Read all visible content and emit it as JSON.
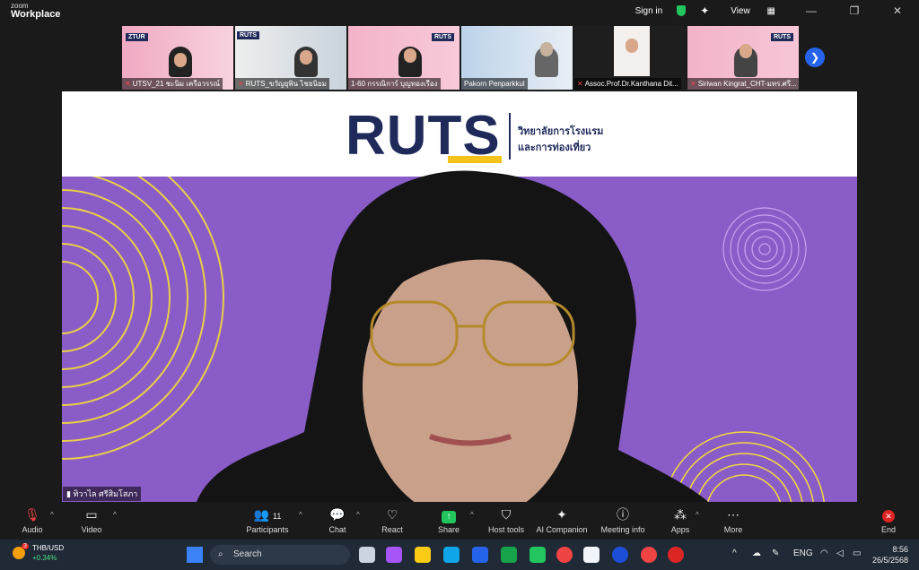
{
  "app": {
    "logo_top": "zoom",
    "logo_bottom": "Workplace"
  },
  "titlebar": {
    "signin": "Sign in",
    "view": "View"
  },
  "thumbnails": [
    {
      "label": "UTSV_21 ชะนิม เครือวรรณ์"
    },
    {
      "label": "RUTS_ขวัญยุพิน ไชยนิยม"
    },
    {
      "label": "1-60 กรรณิการ์ บุญทองเรือง"
    },
    {
      "label": "Pakorn Penparkkul"
    },
    {
      "label": "Assoc.Prof.Dr.Kanthana Dit..."
    },
    {
      "label": "Siriwan Kingrat_CHT-มทร.ศรี..."
    }
  ],
  "main": {
    "logo": "RUTS",
    "subtitle_1": "วิทยาลัยการโรงแรม",
    "subtitle_2": "และการท่องเที่ยว",
    "speaker_name": "ทิวาไล ศรีสิมโสภา"
  },
  "toolbar": {
    "audio": "Audio",
    "video": "Video",
    "participants": "Participants",
    "participants_count": "11",
    "chat": "Chat",
    "react": "React",
    "share": "Share",
    "host_tools": "Host tools",
    "ai_companion": "AI Companion",
    "meeting_info": "Meeting info",
    "apps": "Apps",
    "more": "More",
    "end": "End"
  },
  "taskbar": {
    "badge": "3",
    "currency": "THB/USD",
    "change": "+0.34%",
    "search_placeholder": "Search",
    "lang": "ENG",
    "time": "8:56",
    "date": "26/5/2568"
  },
  "colors": {
    "purple_bg": "#8a5cc8",
    "ruts_navy": "#1f2a5a",
    "ruts_yellow": "#f4c21b",
    "thumb_pink": "#f2b8cc",
    "end_red": "#e02424"
  }
}
